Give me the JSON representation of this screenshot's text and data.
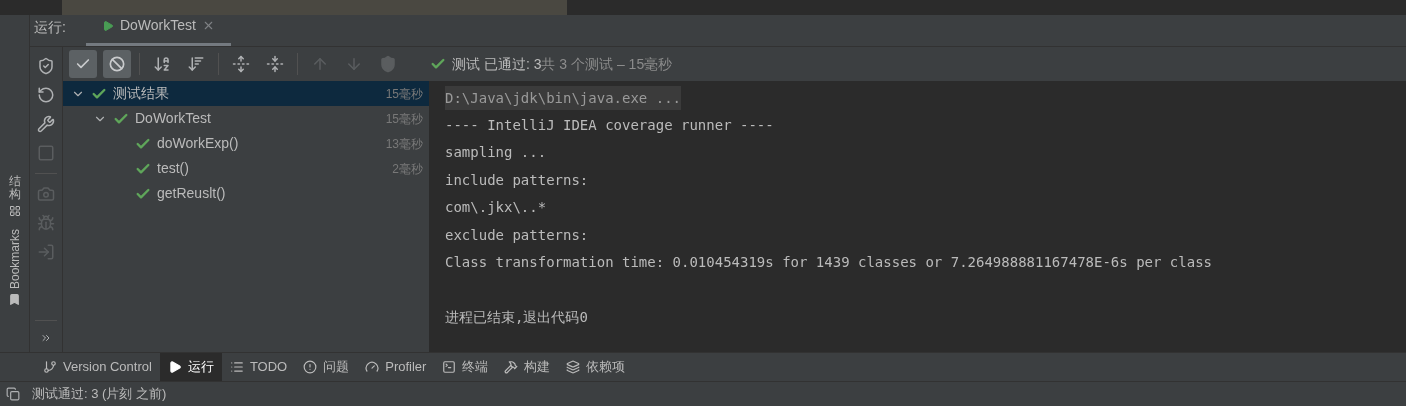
{
  "run_panel": {
    "label": "运行:",
    "tabs": [
      {
        "label": "DoWorkTest",
        "selected": true
      }
    ]
  },
  "toolbar": {
    "toggles": [
      {
        "kind": "passed",
        "selected": true
      },
      {
        "kind": "ignored",
        "selected": true
      }
    ]
  },
  "summary": {
    "passed": "测试 已通过: 3",
    "total": "共 3 个测试 – 15毫秒"
  },
  "tree": [
    {
      "label": "测试结果",
      "time": "15毫秒",
      "selected": true,
      "expanded": true,
      "children": [
        {
          "label": "DoWorkTest",
          "time": "15毫秒",
          "selected": false,
          "expanded": true,
          "children": [
            {
              "label": "doWorkExp()",
              "time": "13毫秒",
              "selected": false
            },
            {
              "label": "test()",
              "time": "2毫秒",
              "selected": false
            },
            {
              "label": "getReuslt()",
              "selected": false
            }
          ]
        }
      ]
    }
  ],
  "console": {
    "lines": [
      {
        "kind": "command",
        "text": "D:\\Java\\jdk\\bin\\java.exe ..."
      },
      {
        "kind": "output",
        "text": "---- IntelliJ IDEA coverage runner ----"
      },
      {
        "kind": "output",
        "text": "sampling ..."
      },
      {
        "kind": "output",
        "text": "include patterns:"
      },
      {
        "kind": "output",
        "text": "com\\.jkx\\..*"
      },
      {
        "kind": "output",
        "text": "exclude patterns:"
      },
      {
        "kind": "output",
        "text": "Class transformation time: 0.010454319s for 1439 classes or 7.264988881167478E-6s per class"
      },
      {
        "kind": "blank"
      },
      {
        "kind": "output",
        "text": "进程已结束,退出代码0"
      }
    ]
  },
  "left_sidebar": [
    {
      "label": "结构",
      "kind": "cjk"
    },
    {
      "label": "Bookmarks",
      "kind": "latin"
    }
  ],
  "bottom_tabs": [
    {
      "kind": "vcs",
      "label": "Version Control",
      "selected": false
    },
    {
      "kind": "run",
      "label": "运行",
      "selected": true
    },
    {
      "kind": "todo",
      "label": "TODO",
      "selected": false
    },
    {
      "kind": "problems",
      "label": "问题",
      "selected": false
    },
    {
      "kind": "profiler",
      "label": "Profiler",
      "selected": false
    },
    {
      "kind": "terminal",
      "label": "终端",
      "selected": false
    },
    {
      "kind": "build",
      "label": "构建",
      "selected": false
    },
    {
      "kind": "deps",
      "label": "依赖项",
      "selected": false
    }
  ],
  "status_bar": {
    "text": "测试通过: 3 (片刻 之前)"
  }
}
